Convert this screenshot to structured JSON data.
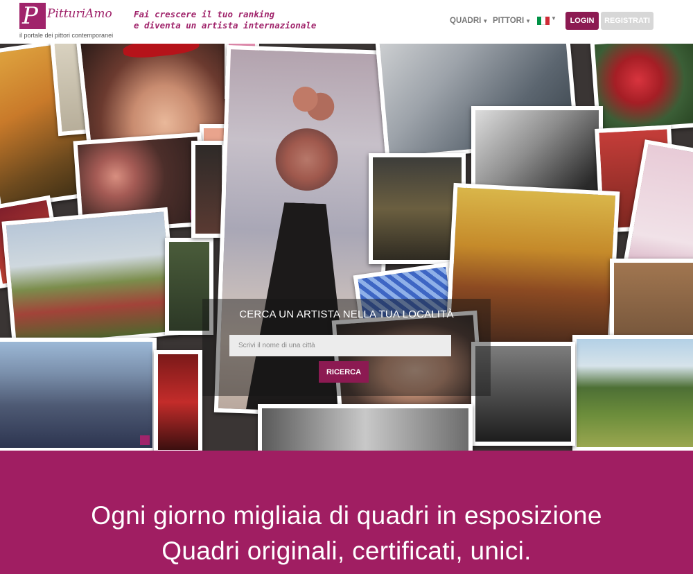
{
  "header": {
    "logo_name": "PitturiAmo",
    "logo_tagline": "il portale dei pittori contemporanei",
    "slogan_line1": "Fai crescere il tuo ranking",
    "slogan_line2": "e diventa un artista internazionale",
    "nav": [
      {
        "label": "QUADRI",
        "icon": "caret-down-icon"
      },
      {
        "label": "PITTORI",
        "icon": "caret-down-icon"
      }
    ],
    "language_flag": "italy-flag-icon",
    "login_label": "LOGIN",
    "register_label": "REGISTRATI"
  },
  "search": {
    "title": "CERCA UN ARTISTA NELLA TUA LOCALITÀ",
    "placeholder": "Scrivi il nome di una città",
    "button_label": "RICERCA"
  },
  "band": {
    "line1": "Ogni giorno migliaia di quadri in esposizione",
    "line2": "Quadri originali, certificati, unici."
  },
  "colors": {
    "brand": "#a0246b",
    "button": "#8c1a52",
    "band": "#a01e62",
    "register_button": "#d7d7d7"
  }
}
